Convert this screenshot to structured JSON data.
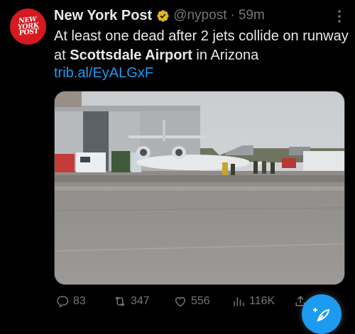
{
  "account": {
    "avatar_logo_lines": [
      "NEW",
      "YORK",
      "POST"
    ],
    "display_name": "New York Post",
    "verified_icon": "gold-verified-badge-icon",
    "handle": "@nypost",
    "separator": "·",
    "time_ago": "59m"
  },
  "tweet": {
    "text_before_bold": "At least one dead after 2 jets collide on runway at ",
    "text_bold": "Scottsdale Airport",
    "text_after_bold": " in Arizona",
    "link": "trib.al/EyALGxF"
  },
  "media": {
    "description_icon": "photo-icon"
  },
  "actions": {
    "replies": "83",
    "retweets": "347",
    "likes": "556",
    "views": "116K"
  },
  "colors": {
    "background": "#000000",
    "text": "#e7e9ea",
    "muted": "#71767b",
    "accent": "#1d9bf0",
    "brand_red": "#d71920",
    "verified_gold": "#e2b719"
  }
}
